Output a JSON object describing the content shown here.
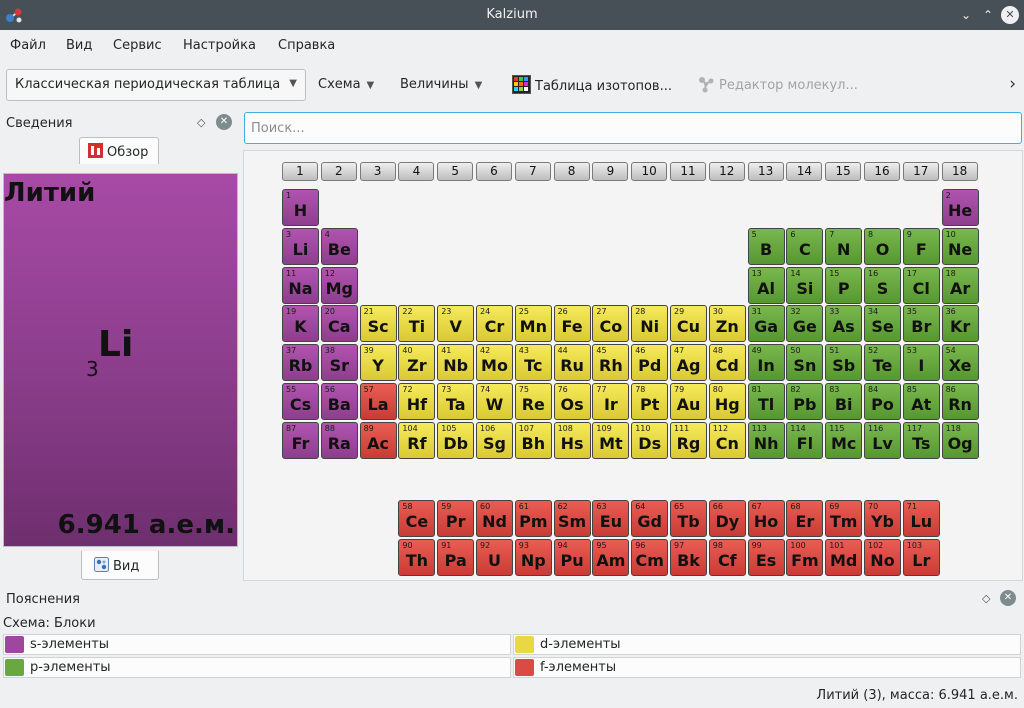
{
  "window": {
    "title": "Kalzium",
    "minimize": "⌄",
    "maximize": "⌃",
    "close": "✕"
  },
  "menu": [
    "Файл",
    "Вид",
    "Сервис",
    "Настройка",
    "Справка"
  ],
  "toolbar": {
    "table_select": "Классическая периодическая таблица",
    "scheme": "Схема",
    "gradients": "Величины",
    "isotope_table": "Таблица изотопов...",
    "molecule_editor": "Редактор молекул...",
    "overflow": "›"
  },
  "info_panel": {
    "title": "Сведения",
    "overview_tab": "Обзор",
    "view_tab": "Вид",
    "element": {
      "name": "Литий",
      "symbol": "Li",
      "number": "3",
      "mass": "6.941 а.е.м.",
      "color": "#9a449a"
    }
  },
  "search": {
    "placeholder": "Поиск...",
    "value": ""
  },
  "groups": [
    "1",
    "2",
    "3",
    "4",
    "5",
    "6",
    "7",
    "8",
    "9",
    "10",
    "11",
    "12",
    "13",
    "14",
    "15",
    "16",
    "17",
    "18"
  ],
  "block_colors": {
    "s": "#9e479e",
    "p": "#68a83f",
    "d": "#e9d846",
    "f": "#d94c45"
  },
  "elements": [
    {
      "n": "1",
      "s": "H",
      "b": "s",
      "g": 1,
      "r": 1
    },
    {
      "n": "2",
      "s": "He",
      "b": "s",
      "g": 18,
      "r": 1
    },
    {
      "n": "3",
      "s": "Li",
      "b": "s",
      "g": 1,
      "r": 2
    },
    {
      "n": "4",
      "s": "Be",
      "b": "s",
      "g": 2,
      "r": 2
    },
    {
      "n": "5",
      "s": "B",
      "b": "p",
      "g": 13,
      "r": 2
    },
    {
      "n": "6",
      "s": "C",
      "b": "p",
      "g": 14,
      "r": 2
    },
    {
      "n": "7",
      "s": "N",
      "b": "p",
      "g": 15,
      "r": 2
    },
    {
      "n": "8",
      "s": "O",
      "b": "p",
      "g": 16,
      "r": 2
    },
    {
      "n": "9",
      "s": "F",
      "b": "p",
      "g": 17,
      "r": 2
    },
    {
      "n": "10",
      "s": "Ne",
      "b": "p",
      "g": 18,
      "r": 2
    },
    {
      "n": "11",
      "s": "Na",
      "b": "s",
      "g": 1,
      "r": 3
    },
    {
      "n": "12",
      "s": "Mg",
      "b": "s",
      "g": 2,
      "r": 3
    },
    {
      "n": "13",
      "s": "Al",
      "b": "p",
      "g": 13,
      "r": 3
    },
    {
      "n": "14",
      "s": "Si",
      "b": "p",
      "g": 14,
      "r": 3
    },
    {
      "n": "15",
      "s": "P",
      "b": "p",
      "g": 15,
      "r": 3
    },
    {
      "n": "16",
      "s": "S",
      "b": "p",
      "g": 16,
      "r": 3
    },
    {
      "n": "17",
      "s": "Cl",
      "b": "p",
      "g": 17,
      "r": 3
    },
    {
      "n": "18",
      "s": "Ar",
      "b": "p",
      "g": 18,
      "r": 3
    },
    {
      "n": "19",
      "s": "K",
      "b": "s",
      "g": 1,
      "r": 4
    },
    {
      "n": "20",
      "s": "Ca",
      "b": "s",
      "g": 2,
      "r": 4
    },
    {
      "n": "21",
      "s": "Sc",
      "b": "d",
      "g": 3,
      "r": 4
    },
    {
      "n": "22",
      "s": "Ti",
      "b": "d",
      "g": 4,
      "r": 4
    },
    {
      "n": "23",
      "s": "V",
      "b": "d",
      "g": 5,
      "r": 4
    },
    {
      "n": "24",
      "s": "Cr",
      "b": "d",
      "g": 6,
      "r": 4
    },
    {
      "n": "25",
      "s": "Mn",
      "b": "d",
      "g": 7,
      "r": 4
    },
    {
      "n": "26",
      "s": "Fe",
      "b": "d",
      "g": 8,
      "r": 4
    },
    {
      "n": "27",
      "s": "Co",
      "b": "d",
      "g": 9,
      "r": 4
    },
    {
      "n": "28",
      "s": "Ni",
      "b": "d",
      "g": 10,
      "r": 4
    },
    {
      "n": "29",
      "s": "Cu",
      "b": "d",
      "g": 11,
      "r": 4
    },
    {
      "n": "30",
      "s": "Zn",
      "b": "d",
      "g": 12,
      "r": 4
    },
    {
      "n": "31",
      "s": "Ga",
      "b": "p",
      "g": 13,
      "r": 4
    },
    {
      "n": "32",
      "s": "Ge",
      "b": "p",
      "g": 14,
      "r": 4
    },
    {
      "n": "33",
      "s": "As",
      "b": "p",
      "g": 15,
      "r": 4
    },
    {
      "n": "34",
      "s": "Se",
      "b": "p",
      "g": 16,
      "r": 4
    },
    {
      "n": "35",
      "s": "Br",
      "b": "p",
      "g": 17,
      "r": 4
    },
    {
      "n": "36",
      "s": "Kr",
      "b": "p",
      "g": 18,
      "r": 4
    },
    {
      "n": "37",
      "s": "Rb",
      "b": "s",
      "g": 1,
      "r": 5
    },
    {
      "n": "38",
      "s": "Sr",
      "b": "s",
      "g": 2,
      "r": 5
    },
    {
      "n": "39",
      "s": "Y",
      "b": "d",
      "g": 3,
      "r": 5
    },
    {
      "n": "40",
      "s": "Zr",
      "b": "d",
      "g": 4,
      "r": 5
    },
    {
      "n": "41",
      "s": "Nb",
      "b": "d",
      "g": 5,
      "r": 5
    },
    {
      "n": "42",
      "s": "Mo",
      "b": "d",
      "g": 6,
      "r": 5
    },
    {
      "n": "43",
      "s": "Tc",
      "b": "d",
      "g": 7,
      "r": 5
    },
    {
      "n": "44",
      "s": "Ru",
      "b": "d",
      "g": 8,
      "r": 5
    },
    {
      "n": "45",
      "s": "Rh",
      "b": "d",
      "g": 9,
      "r": 5
    },
    {
      "n": "46",
      "s": "Pd",
      "b": "d",
      "g": 10,
      "r": 5
    },
    {
      "n": "47",
      "s": "Ag",
      "b": "d",
      "g": 11,
      "r": 5
    },
    {
      "n": "48",
      "s": "Cd",
      "b": "d",
      "g": 12,
      "r": 5
    },
    {
      "n": "49",
      "s": "In",
      "b": "p",
      "g": 13,
      "r": 5
    },
    {
      "n": "50",
      "s": "Sn",
      "b": "p",
      "g": 14,
      "r": 5
    },
    {
      "n": "51",
      "s": "Sb",
      "b": "p",
      "g": 15,
      "r": 5
    },
    {
      "n": "52",
      "s": "Te",
      "b": "p",
      "g": 16,
      "r": 5
    },
    {
      "n": "53",
      "s": "I",
      "b": "p",
      "g": 17,
      "r": 5
    },
    {
      "n": "54",
      "s": "Xe",
      "b": "p",
      "g": 18,
      "r": 5
    },
    {
      "n": "55",
      "s": "Cs",
      "b": "s",
      "g": 1,
      "r": 6
    },
    {
      "n": "56",
      "s": "Ba",
      "b": "s",
      "g": 2,
      "r": 6
    },
    {
      "n": "57",
      "s": "La",
      "b": "f",
      "g": 3,
      "r": 6
    },
    {
      "n": "72",
      "s": "Hf",
      "b": "d",
      "g": 4,
      "r": 6
    },
    {
      "n": "73",
      "s": "Ta",
      "b": "d",
      "g": 5,
      "r": 6
    },
    {
      "n": "74",
      "s": "W",
      "b": "d",
      "g": 6,
      "r": 6
    },
    {
      "n": "75",
      "s": "Re",
      "b": "d",
      "g": 7,
      "r": 6
    },
    {
      "n": "76",
      "s": "Os",
      "b": "d",
      "g": 8,
      "r": 6
    },
    {
      "n": "77",
      "s": "Ir",
      "b": "d",
      "g": 9,
      "r": 6
    },
    {
      "n": "78",
      "s": "Pt",
      "b": "d",
      "g": 10,
      "r": 6
    },
    {
      "n": "79",
      "s": "Au",
      "b": "d",
      "g": 11,
      "r": 6
    },
    {
      "n": "80",
      "s": "Hg",
      "b": "d",
      "g": 12,
      "r": 6
    },
    {
      "n": "81",
      "s": "Tl",
      "b": "p",
      "g": 13,
      "r": 6
    },
    {
      "n": "82",
      "s": "Pb",
      "b": "p",
      "g": 14,
      "r": 6
    },
    {
      "n": "83",
      "s": "Bi",
      "b": "p",
      "g": 15,
      "r": 6
    },
    {
      "n": "84",
      "s": "Po",
      "b": "p",
      "g": 16,
      "r": 6
    },
    {
      "n": "85",
      "s": "At",
      "b": "p",
      "g": 17,
      "r": 6
    },
    {
      "n": "86",
      "s": "Rn",
      "b": "p",
      "g": 18,
      "r": 6
    },
    {
      "n": "87",
      "s": "Fr",
      "b": "s",
      "g": 1,
      "r": 7
    },
    {
      "n": "88",
      "s": "Ra",
      "b": "s",
      "g": 2,
      "r": 7
    },
    {
      "n": "89",
      "s": "Ac",
      "b": "f",
      "g": 3,
      "r": 7
    },
    {
      "n": "104",
      "s": "Rf",
      "b": "d",
      "g": 4,
      "r": 7
    },
    {
      "n": "105",
      "s": "Db",
      "b": "d",
      "g": 5,
      "r": 7
    },
    {
      "n": "106",
      "s": "Sg",
      "b": "d",
      "g": 6,
      "r": 7
    },
    {
      "n": "107",
      "s": "Bh",
      "b": "d",
      "g": 7,
      "r": 7
    },
    {
      "n": "108",
      "s": "Hs",
      "b": "d",
      "g": 8,
      "r": 7
    },
    {
      "n": "109",
      "s": "Mt",
      "b": "d",
      "g": 9,
      "r": 7
    },
    {
      "n": "110",
      "s": "Ds",
      "b": "d",
      "g": 10,
      "r": 7
    },
    {
      "n": "111",
      "s": "Rg",
      "b": "d",
      "g": 11,
      "r": 7
    },
    {
      "n": "112",
      "s": "Cn",
      "b": "d",
      "g": 12,
      "r": 7
    },
    {
      "n": "113",
      "s": "Nh",
      "b": "p",
      "g": 13,
      "r": 7
    },
    {
      "n": "114",
      "s": "Fl",
      "b": "p",
      "g": 14,
      "r": 7
    },
    {
      "n": "115",
      "s": "Mc",
      "b": "p",
      "g": 15,
      "r": 7
    },
    {
      "n": "116",
      "s": "Lv",
      "b": "p",
      "g": 16,
      "r": 7
    },
    {
      "n": "117",
      "s": "Ts",
      "b": "p",
      "g": 17,
      "r": 7
    },
    {
      "n": "118",
      "s": "Og",
      "b": "p",
      "g": 18,
      "r": 7
    },
    {
      "n": "58",
      "s": "Ce",
      "b": "f",
      "g": 4,
      "r": 9
    },
    {
      "n": "59",
      "s": "Pr",
      "b": "f",
      "g": 5,
      "r": 9
    },
    {
      "n": "60",
      "s": "Nd",
      "b": "f",
      "g": 6,
      "r": 9
    },
    {
      "n": "61",
      "s": "Pm",
      "b": "f",
      "g": 7,
      "r": 9
    },
    {
      "n": "62",
      "s": "Sm",
      "b": "f",
      "g": 8,
      "r": 9
    },
    {
      "n": "63",
      "s": "Eu",
      "b": "f",
      "g": 9,
      "r": 9
    },
    {
      "n": "64",
      "s": "Gd",
      "b": "f",
      "g": 10,
      "r": 9
    },
    {
      "n": "65",
      "s": "Tb",
      "b": "f",
      "g": 11,
      "r": 9
    },
    {
      "n": "66",
      "s": "Dy",
      "b": "f",
      "g": 12,
      "r": 9
    },
    {
      "n": "67",
      "s": "Ho",
      "b": "f",
      "g": 13,
      "r": 9
    },
    {
      "n": "68",
      "s": "Er",
      "b": "f",
      "g": 14,
      "r": 9
    },
    {
      "n": "69",
      "s": "Tm",
      "b": "f",
      "g": 15,
      "r": 9
    },
    {
      "n": "70",
      "s": "Yb",
      "b": "f",
      "g": 16,
      "r": 9
    },
    {
      "n": "71",
      "s": "Lu",
      "b": "f",
      "g": 17,
      "r": 9
    },
    {
      "n": "90",
      "s": "Th",
      "b": "f",
      "g": 4,
      "r": 10
    },
    {
      "n": "91",
      "s": "Pa",
      "b": "f",
      "g": 5,
      "r": 10
    },
    {
      "n": "92",
      "s": "U",
      "b": "f",
      "g": 6,
      "r": 10
    },
    {
      "n": "93",
      "s": "Np",
      "b": "f",
      "g": 7,
      "r": 10
    },
    {
      "n": "94",
      "s": "Pu",
      "b": "f",
      "g": 8,
      "r": 10
    },
    {
      "n": "95",
      "s": "Am",
      "b": "f",
      "g": 9,
      "r": 10
    },
    {
      "n": "96",
      "s": "Cm",
      "b": "f",
      "g": 10,
      "r": 10
    },
    {
      "n": "97",
      "s": "Bk",
      "b": "f",
      "g": 11,
      "r": 10
    },
    {
      "n": "98",
      "s": "Cf",
      "b": "f",
      "g": 12,
      "r": 10
    },
    {
      "n": "99",
      "s": "Es",
      "b": "f",
      "g": 13,
      "r": 10
    },
    {
      "n": "100",
      "s": "Fm",
      "b": "f",
      "g": 14,
      "r": 10
    },
    {
      "n": "101",
      "s": "Md",
      "b": "f",
      "g": 15,
      "r": 10
    },
    {
      "n": "102",
      "s": "No",
      "b": "f",
      "g": 16,
      "r": 10
    },
    {
      "n": "103",
      "s": "Lr",
      "b": "f",
      "g": 17,
      "r": 10
    }
  ],
  "legend": {
    "title": "Пояснения",
    "scheme_label": "Схема: Блоки",
    "items": [
      {
        "label": "s-элементы",
        "block": "s"
      },
      {
        "label": "d-элементы",
        "block": "d"
      },
      {
        "label": "p-элементы",
        "block": "p"
      },
      {
        "label": "f-элементы",
        "block": "f"
      }
    ]
  },
  "status": "Литий (3), масса: 6.941 а.е.м.",
  "icons": {
    "app": "kalzium-molecule-icon",
    "overview_tab": "overview-icon",
    "view_tab": "view-icon",
    "isotope": "isotope-grid-icon",
    "molecule": "molecule-icon",
    "float": "float-icon",
    "close": "close-icon"
  }
}
